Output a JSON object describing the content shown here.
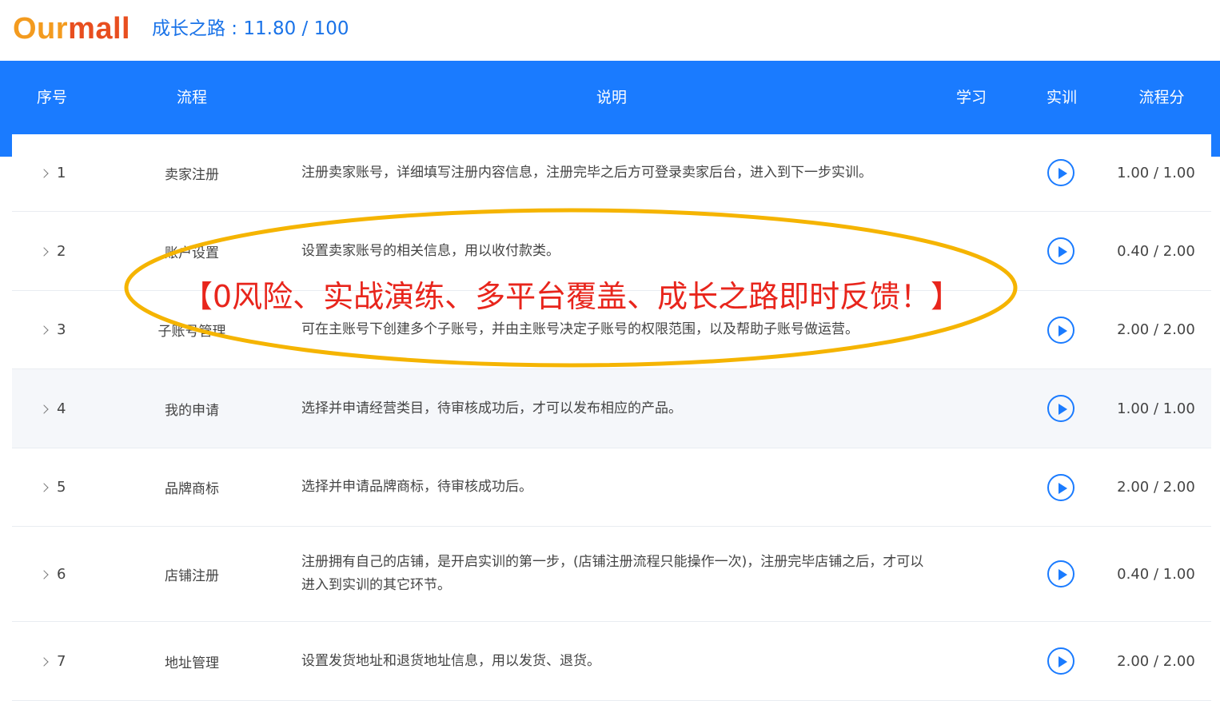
{
  "header": {
    "logo_part1": "Our",
    "logo_part2": "mall",
    "progress": "成长之路 : 11.80 / 100"
  },
  "table": {
    "columns": [
      "序号",
      "流程",
      "说明",
      "学习",
      "实训",
      "流程分"
    ],
    "rows": [
      {
        "num": "1",
        "process": "卖家注册",
        "desc": "注册卖家账号，详细填写注册内容信息，注册完毕之后方可登录卖家后台，进入到下一步实训。",
        "score": "1.00 / 1.00"
      },
      {
        "num": "2",
        "process": "账户设置",
        "desc": "设置卖家账号的相关信息，用以收付款类。",
        "score": "0.40 / 2.00"
      },
      {
        "num": "3",
        "process": "子账号管理",
        "desc": "可在主账号下创建多个子账号，并由主账号决定子账号的权限范围，以及帮助子账号做运营。",
        "score": "2.00 / 2.00"
      },
      {
        "num": "4",
        "process": "我的申请",
        "desc": "选择并申请经营类目，待审核成功后，才可以发布相应的产品。",
        "score": "1.00 / 1.00"
      },
      {
        "num": "5",
        "process": "品牌商标",
        "desc": "选择并申请品牌商标，待审核成功后。",
        "score": "2.00 / 2.00"
      },
      {
        "num": "6",
        "process": "店铺注册",
        "desc": "注册拥有自己的店铺，是开启实训的第一步，(店铺注册流程只能操作一次)，注册完毕店铺之后，才可以进入到实训的其它环节。",
        "score": "0.40 / 1.00"
      },
      {
        "num": "7",
        "process": "地址管理",
        "desc": "设置发货地址和退货地址信息，用以发货、退货。",
        "score": "2.00 / 2.00"
      }
    ]
  },
  "annotation": {
    "text": "【0风险、实战演练、多平台覆盖、成长之路即时反馈！】"
  },
  "icons": {
    "expand": "chevron-right-icon",
    "train": "play-circle-icon"
  },
  "colors": {
    "primary": "#1a7bff",
    "logo_orange": "#f39b1f",
    "logo_red": "#e84e1f",
    "annotation_red": "#e8251c",
    "ellipse_gold": "#f5b400"
  }
}
